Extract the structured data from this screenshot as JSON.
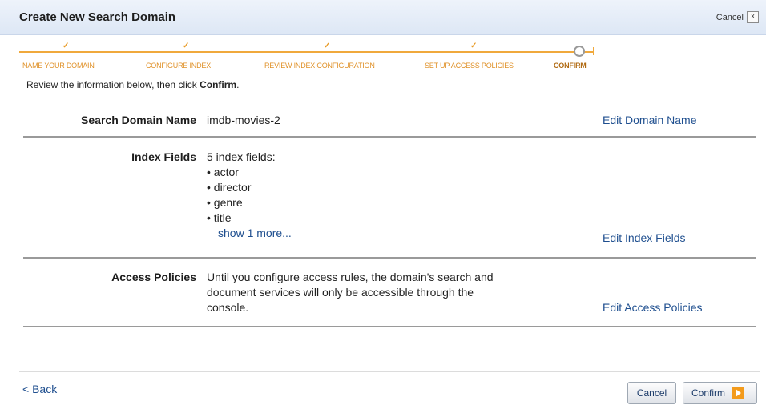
{
  "header": {
    "title": "Create New Search Domain",
    "cancel_label": "Cancel",
    "close_glyph": "x"
  },
  "wizard": {
    "steps": [
      {
        "label": "NAME YOUR DOMAIN",
        "state": "complete"
      },
      {
        "label": "CONFIGURE INDEX",
        "state": "complete"
      },
      {
        "label": "REVIEW INDEX CONFIGURATION",
        "state": "complete"
      },
      {
        "label": "SET UP ACCESS POLICIES",
        "state": "complete"
      },
      {
        "label": "CONFIRM",
        "state": "current"
      }
    ],
    "check_glyph": "✓",
    "accent_color": "#f0a93c"
  },
  "intro": {
    "prefix": "Review the information below, then click ",
    "bold": "Confirm",
    "suffix": "."
  },
  "domain": {
    "label": "Search Domain Name",
    "value": "imdb-movies-2",
    "edit_label": "Edit Domain Name"
  },
  "index": {
    "label": "Index Fields",
    "summary": "5 index fields:",
    "fields": [
      "actor",
      "director",
      "genre",
      "title"
    ],
    "more_label": "show 1 more...",
    "edit_label": "Edit Index Fields"
  },
  "access": {
    "label": "Access Policies",
    "lines": [
      "Until you configure access rules, the domain's search and",
      "document services will only be accessible through the",
      "console."
    ],
    "edit_label": "Edit Access Policies"
  },
  "footer": {
    "back_label": "< Back",
    "cancel_label": "Cancel",
    "confirm_label": "Confirm"
  },
  "icons": {
    "close": "close-icon",
    "confirm_arrow": "arrow-right-icon",
    "resize": "resize-grip-icon"
  }
}
